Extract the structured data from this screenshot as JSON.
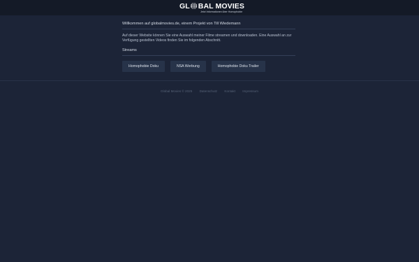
{
  "header": {
    "logo": {
      "text_left": "GL",
      "text_right": "BAL MOVIES",
      "tagline": "Jetzt Informationen über Homophobie"
    }
  },
  "main": {
    "welcome": "Willkommen auf globalmovies.de, einem Projekt von Till Wiedemann",
    "intro": "Auf dieser Website können Sie eine Auswahl meiner Filme streamen und downloaden. Eine Auswahl an zur Verfügung gestellten Videos finden Sie im folgenden Abschnitt.",
    "streams_title": "Streams",
    "streams": [
      {
        "label": "Homophobie Doku"
      },
      {
        "label": "NSA Werbung"
      },
      {
        "label": "Homophobie Doku Trailer"
      }
    ]
  },
  "footer": {
    "copyright": "Global Movies © 2025",
    "links": [
      {
        "label": "Datenschutz"
      },
      {
        "label": "Kontakt"
      },
      {
        "label": "Impressum"
      }
    ]
  },
  "colors": {
    "background": "#1c2437",
    "header_background": "#141a27",
    "button_background": "#273349"
  },
  "icons": {
    "logo_globe": "globe-icon"
  }
}
